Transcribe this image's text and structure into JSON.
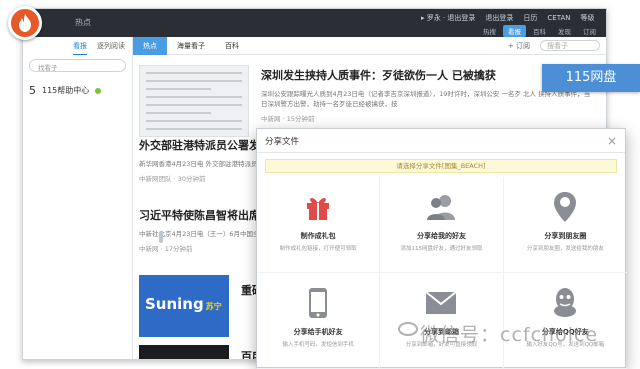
{
  "window": {
    "title": "热点",
    "user_menu": [
      "▸ 罗永 · 退出登录",
      "退出登录",
      "日历",
      "CETAN",
      "等级"
    ],
    "top_tabs": [
      "热搜",
      "看报",
      "百科",
      "发现",
      "订阅"
    ],
    "active_top_tab": "看报"
  },
  "sidebar": {
    "tabs": [
      "看报",
      "逐列阅读"
    ],
    "search_placeholder": "找看子",
    "item_num": "5",
    "item_label": "115帮助中心"
  },
  "main": {
    "tabs": [
      "热点",
      "海量看子",
      "百科"
    ],
    "subscribe_label": "+ 订阅",
    "search_placeholder": "搜看子",
    "articles": [
      {
        "title": "深圳发生挟持人质事件：歹徒欲伤一人 已被擒获",
        "desc": "深圳公安跟踪曝光人质到4月23日电（记者李吉京深圳报道），19时许时，深圳公安 一名歹 北人 挟持人质事件，当日深圳警方出警，劫持一名歹徒已经被擒获，技",
        "meta": "中新网 · 15分钟前"
      },
      {
        "title": "外交部驻港特派员公署发言人",
        "desc": "新华网香港4月23日电 外交部驻港特派员公署发言人 23日 就驻港特派员公署主要 发言了 国家",
        "meta": "中新网团队 · 30分钟前"
      },
      {
        "title": "习近平特使陈昌智将出席",
        "desc": "中新社北京4月23日电（王一）6月中国全国人大常委会副委员长 陈昌智",
        "meta": "中新网 · 17分钟前"
      },
      {
        "title": "重磅推",
        "desc": "",
        "meta": ""
      },
      {
        "title": "百度拟",
        "desc": "",
        "meta": ""
      }
    ]
  },
  "brand_tag": "115网盘",
  "dialog": {
    "title": "分享文件",
    "close": "×",
    "tip": "请选择分享文件[图集_BEACH]",
    "options": [
      {
        "icon": "gift-icon",
        "label": "制作成礼包",
        "sub": "制作成礼包链接，打开便可领取",
        "color": "#e14b47"
      },
      {
        "icon": "friends-icon",
        "label": "分享给我的好友",
        "sub": "添加115网盘好友，通过好友领取",
        "color": "#8a8d93"
      },
      {
        "icon": "location-icon",
        "label": "分享到朋友圈",
        "sub": "分享到朋友圈，发送给我的朋友",
        "color": "#8a8d93"
      },
      {
        "icon": "phone-icon",
        "label": "分享给手机好友",
        "sub": "输入手机号码，发短信到手机",
        "color": "#8a8d93"
      },
      {
        "icon": "mail-icon",
        "label": "分享到邮箱",
        "sub": "分享到邮箱，好友可直接领取",
        "color": "#8a8d93"
      },
      {
        "icon": "qq-icon",
        "label": "分享给QQ好友",
        "sub": "输入好友QQ号，发送到QQ邮箱",
        "color": "#8a8d93"
      }
    ]
  },
  "watermark": "微信号：ccfchoice",
  "thumb": {
    "brand": "Suning",
    "brand_cn": "苏宁"
  }
}
